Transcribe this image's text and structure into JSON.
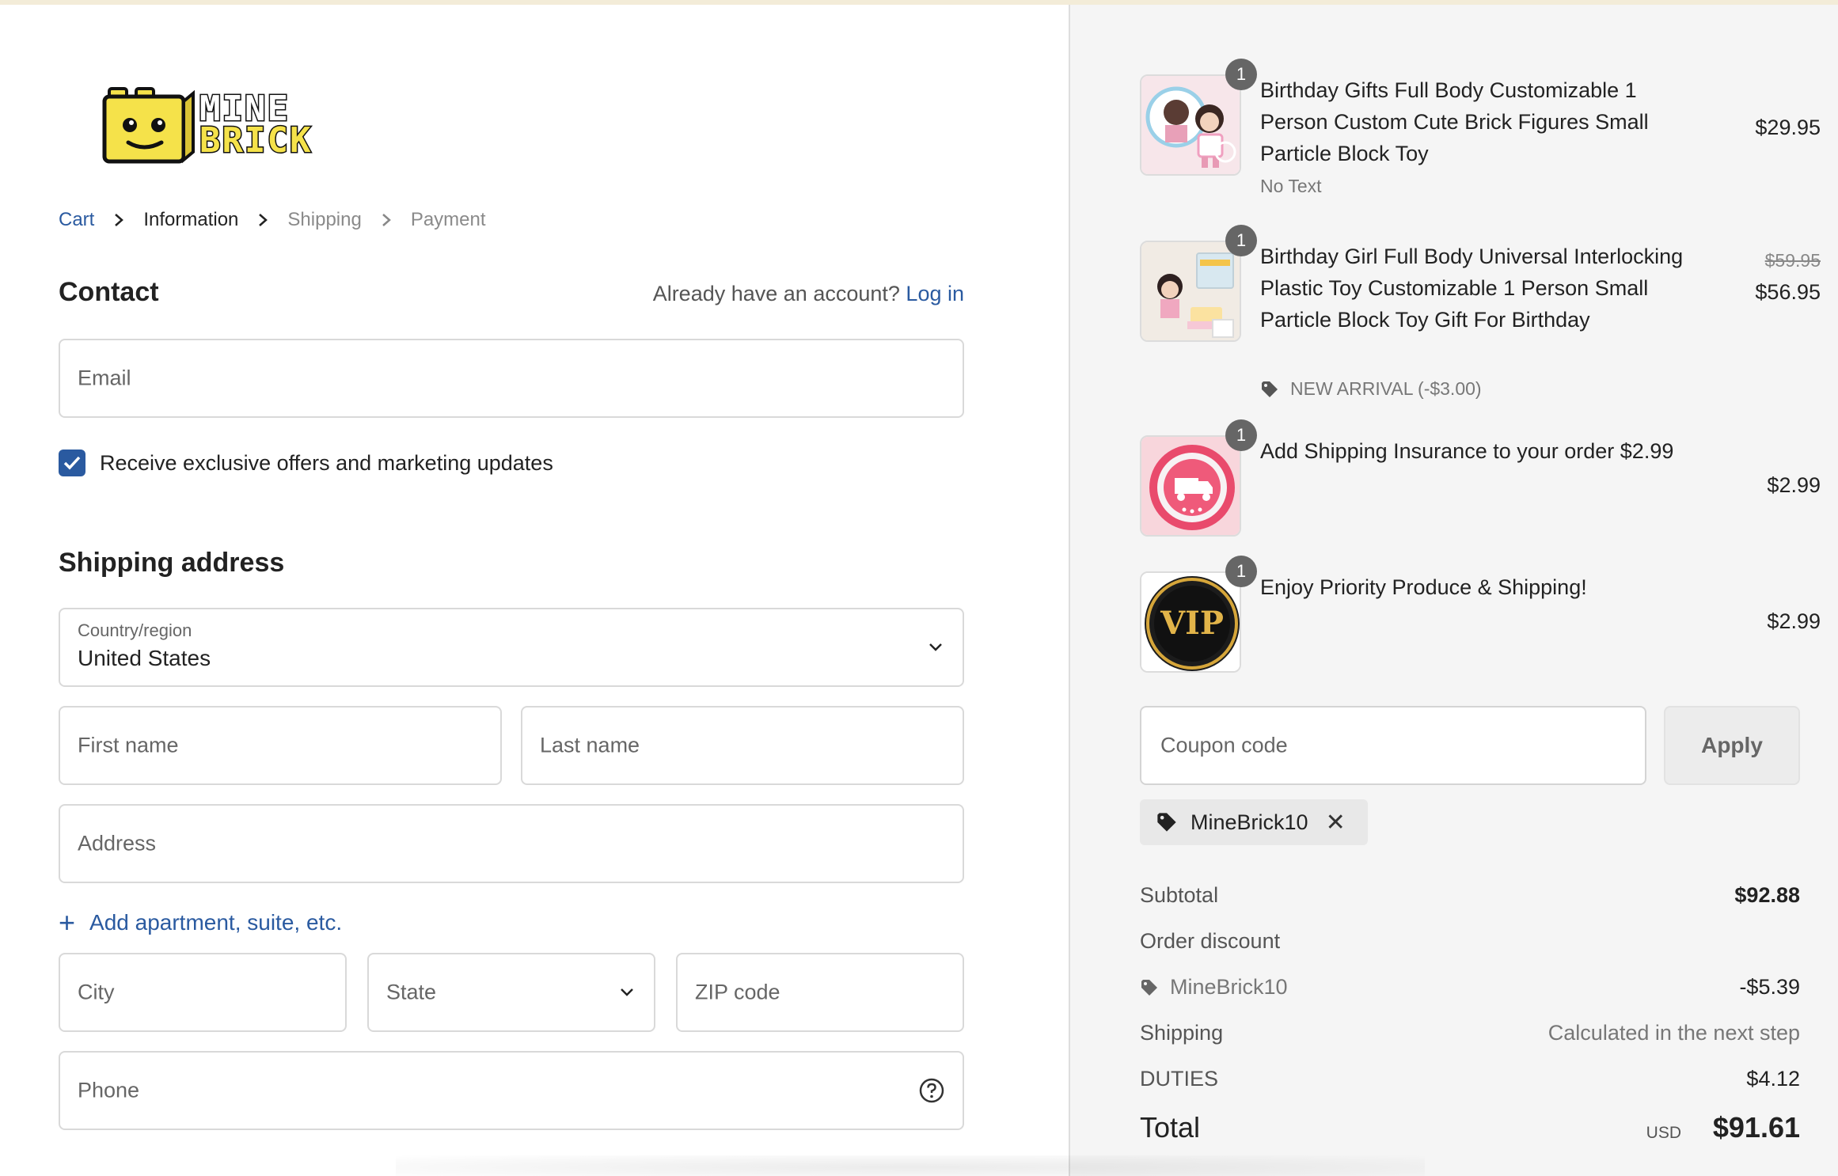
{
  "logo": {
    "line1": "MINE",
    "line2": "BRICK"
  },
  "breadcrumb": {
    "cart": "Cart",
    "information": "Information",
    "shipping": "Shipping",
    "payment": "Payment"
  },
  "contact": {
    "heading": "Contact",
    "account_prompt": "Already have an account?",
    "login_link": "Log in",
    "email_placeholder": "Email",
    "marketing_label": "Receive exclusive offers and marketing updates",
    "marketing_checked": true
  },
  "shipping_address": {
    "heading": "Shipping address",
    "country_label": "Country/region",
    "country_value": "United States",
    "first_name_placeholder": "First name",
    "last_name_placeholder": "Last name",
    "address_placeholder": "Address",
    "add_apartment": "Add apartment, suite, etc.",
    "city_placeholder": "City",
    "state_placeholder": "State",
    "zip_placeholder": "ZIP code",
    "phone_placeholder": "Phone"
  },
  "order": {
    "items": [
      {
        "qty": "1",
        "title": "Birthday Gifts Full Body Customizable 1 Person Custom Cute Brick Figures Small Particle Block Toy",
        "sub": "No Text",
        "price": "$29.95"
      },
      {
        "qty": "1",
        "title": "Birthday Girl Full Body Universal Interlocking Plastic Toy Customizable 1 Person Small Particle Block Toy Gift For Birthday",
        "sub": "NEW ARRIVAL (-$3.00)",
        "original_price": "$59.95",
        "price": "$56.95"
      },
      {
        "qty": "1",
        "title": "Add Shipping Insurance to your order $2.99",
        "price": "$2.99"
      },
      {
        "qty": "1",
        "title": "Enjoy Priority Produce & Shipping!",
        "price": "$2.99",
        "thumb_text": "VIP"
      }
    ],
    "coupon_placeholder": "Coupon code",
    "apply_label": "Apply",
    "applied_code": "MineBrick10",
    "summary": {
      "subtotal_label": "Subtotal",
      "subtotal": "$92.88",
      "discount_label": "Order discount",
      "discount_code": "MineBrick10",
      "discount": "-$5.39",
      "shipping_label": "Shipping",
      "shipping": "Calculated in the next step",
      "duties_label": "DUTIES",
      "duties": "$4.12",
      "total_label": "Total",
      "currency": "USD",
      "total": "$91.61"
    }
  },
  "colors": {
    "accent": "#2a5aa0",
    "badge": "#666666",
    "summary_bg": "#f5f5f5"
  }
}
